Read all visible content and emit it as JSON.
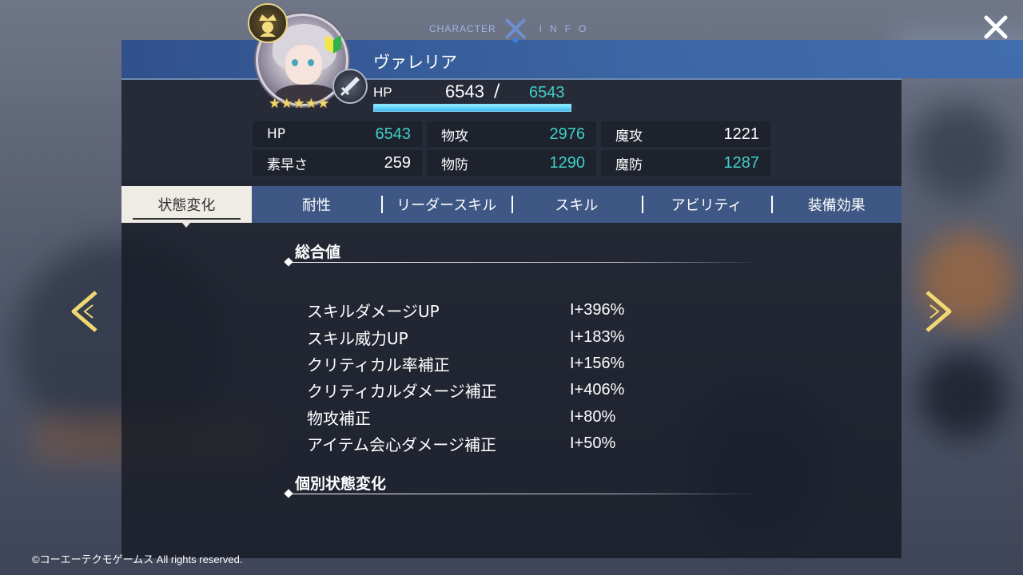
{
  "header": {
    "title_left": "CHARACTER",
    "title_right": "INFO",
    "close_icon": "close-icon"
  },
  "character": {
    "name": "ヴァレリア",
    "stars": "★★★★★",
    "hp_label": "HP",
    "hp_current": "6543",
    "hp_separator": "/",
    "hp_max": "6543",
    "hp_fill": 1.0
  },
  "stats": [
    {
      "label": "HP",
      "value": "6543",
      "color": "teal"
    },
    {
      "label": "物攻",
      "value": "2976",
      "color": "teal"
    },
    {
      "label": "魔攻",
      "value": "1221",
      "color": "white"
    },
    {
      "label": "素早さ",
      "value": "259",
      "color": "white"
    },
    {
      "label": "物防",
      "value": "1290",
      "color": "teal"
    },
    {
      "label": "魔防",
      "value": "1287",
      "color": "teal"
    }
  ],
  "tabs": [
    {
      "label": "状態変化",
      "active": true
    },
    {
      "label": "耐性",
      "active": false
    },
    {
      "label": "リーダースキル",
      "active": false
    },
    {
      "label": "スキル",
      "active": false
    },
    {
      "label": "アビリティ",
      "active": false
    },
    {
      "label": "装備効果",
      "active": false
    }
  ],
  "sections": {
    "total": "総合値",
    "individual": "個別状態変化"
  },
  "effects": [
    {
      "name": "スキルダメージUP",
      "value": "+396%"
    },
    {
      "name": "スキル威力UP",
      "value": "+183%"
    },
    {
      "name": "クリティカル率補正",
      "value": "+156%"
    },
    {
      "name": "クリティカルダメージ補正",
      "value": "+406%"
    },
    {
      "name": "物攻補正",
      "value": "+80%"
    },
    {
      "name": "アイテム会心ダメージ補正",
      "value": "+50%"
    }
  ],
  "footer": {
    "copyright": "©コーエーテクモゲームス All rights reserved."
  },
  "colors": {
    "accent_teal": "#3fd0c8",
    "tab_bar": "#3e5784",
    "tab_active": "#efece6",
    "arrow_gold": "#f0d874"
  }
}
